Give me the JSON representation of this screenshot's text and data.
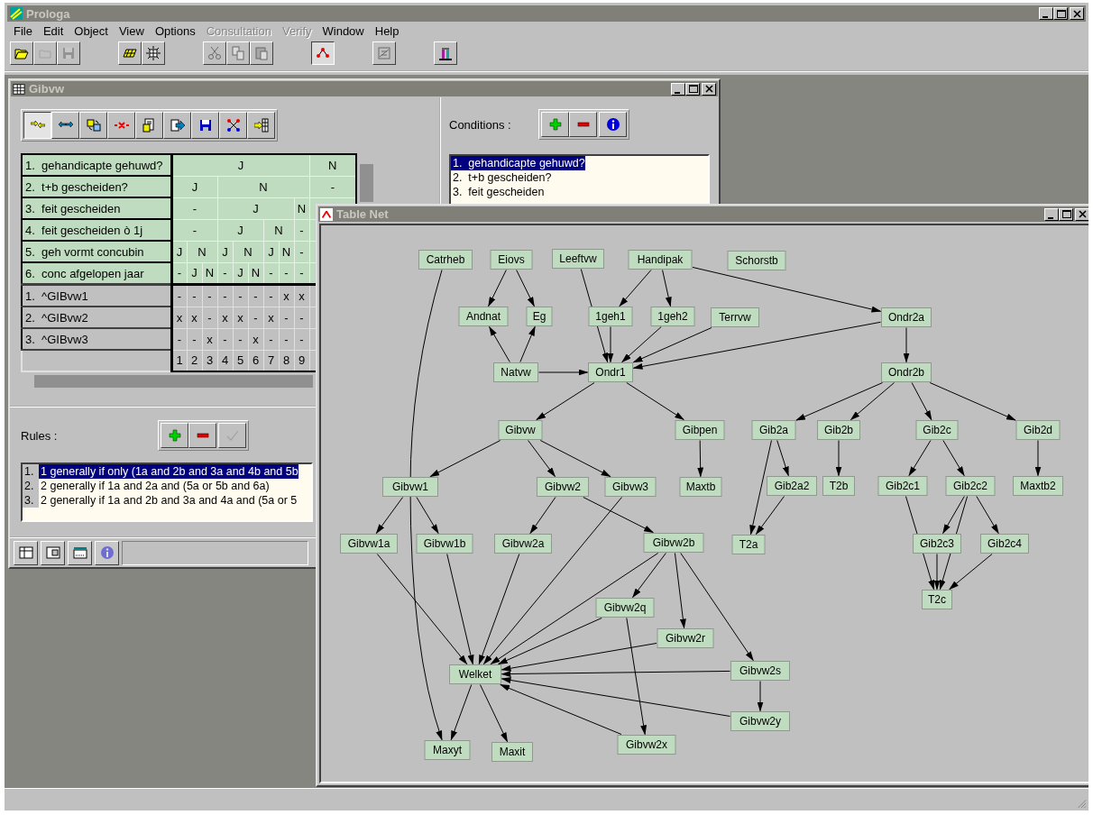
{
  "app": {
    "title": "Prologa"
  },
  "menu": [
    {
      "label": "File",
      "disabled": false
    },
    {
      "label": "Edit",
      "disabled": false
    },
    {
      "label": "Object",
      "disabled": false
    },
    {
      "label": "View",
      "disabled": false
    },
    {
      "label": "Options",
      "disabled": false
    },
    {
      "label": "Consultation",
      "disabled": true
    },
    {
      "label": "Verify",
      "disabled": true
    },
    {
      "label": "Window",
      "disabled": false
    },
    {
      "label": "Help",
      "disabled": false
    }
  ],
  "toolbar": {
    "groups": [
      {
        "buttons": [
          {
            "kind": "open",
            "disabled": false,
            "pressed": false
          },
          {
            "kind": "folder",
            "disabled": true,
            "pressed": false
          },
          {
            "kind": "save",
            "disabled": true,
            "pressed": false
          }
        ]
      },
      {
        "buttons": [
          {
            "kind": "grid-entry",
            "disabled": false,
            "pressed": false
          },
          {
            "kind": "grid",
            "disabled": false,
            "pressed": false
          }
        ]
      },
      {
        "buttons": [
          {
            "kind": "cut",
            "disabled": true,
            "pressed": false
          },
          {
            "kind": "copy",
            "disabled": true,
            "pressed": false
          },
          {
            "kind": "paste",
            "disabled": true,
            "pressed": false
          }
        ]
      },
      {
        "buttons": [
          {
            "kind": "net",
            "disabled": false,
            "pressed": true
          }
        ]
      },
      {
        "buttons": [
          {
            "kind": "compare",
            "disabled": true,
            "pressed": false
          }
        ]
      },
      {
        "buttons": [
          {
            "kind": "chart",
            "disabled": false,
            "pressed": false
          }
        ]
      }
    ]
  },
  "gibvw_window": {
    "title": "Gibvw",
    "toolbar": [
      {
        "kind": "merge",
        "pressed": true
      },
      {
        "kind": "split",
        "pressed": false
      },
      {
        "kind": "swap",
        "pressed": false
      },
      {
        "kind": "delete",
        "pressed": false
      },
      {
        "kind": "document",
        "pressed": false
      },
      {
        "kind": "export",
        "pressed": false
      },
      {
        "kind": "save-blue",
        "pressed": false
      },
      {
        "kind": "network",
        "pressed": false
      },
      {
        "kind": "table-arrow",
        "pressed": false
      }
    ],
    "conditions": [
      "1.  gehandicapte gehuwd?",
      "2.  t+b gescheiden?",
      "3.  feit gescheiden",
      "4.  feit gescheiden ò 1j",
      "5.  geh vormt concubin",
      "6.  conc afgelopen jaar"
    ],
    "decision_tree": [
      {
        "value": "J",
        "children": [
          {
            "value": "J",
            "children": [
              {
                "value": "-",
                "children": [
                  {
                    "value": "-",
                    "children": [
                      {
                        "value": "J",
                        "children": [
                          {
                            "value": "-"
                          }
                        ]
                      },
                      {
                        "value": "N",
                        "children": [
                          {
                            "value": "J"
                          },
                          {
                            "value": "N"
                          }
                        ]
                      }
                    ]
                  }
                ]
              }
            ]
          },
          {
            "value": "N",
            "children": [
              {
                "value": "J",
                "children": [
                  {
                    "value": "J",
                    "children": [
                      {
                        "value": "J",
                        "children": [
                          {
                            "value": "-"
                          }
                        ]
                      },
                      {
                        "value": "N",
                        "children": [
                          {
                            "value": "J"
                          },
                          {
                            "value": "N"
                          }
                        ]
                      }
                    ]
                  },
                  {
                    "value": "N",
                    "children": [
                      {
                        "value": "J",
                        "children": [
                          {
                            "value": "-"
                          }
                        ]
                      },
                      {
                        "value": "N",
                        "children": [
                          {
                            "value": "-"
                          }
                        ]
                      }
                    ]
                  }
                ]
              },
              {
                "value": "N",
                "children": [
                  {
                    "value": "-",
                    "children": [
                      {
                        "value": "-",
                        "children": [
                          {
                            "value": "-"
                          }
                        ]
                      }
                    ]
                  }
                ]
              }
            ]
          }
        ]
      },
      {
        "value": "N",
        "children": [
          {
            "value": "-"
          }
        ]
      }
    ],
    "actions": [
      {
        "label": "1.  ^GIBvw1",
        "marks": [
          "-",
          "-",
          "-",
          "-",
          "-",
          "-",
          "-",
          "x",
          "x"
        ]
      },
      {
        "label": "2.  ^GIBvw2",
        "marks": [
          "x",
          "x",
          "-",
          "x",
          "x",
          "-",
          "x",
          "-",
          "-"
        ]
      },
      {
        "label": "3.  ^GIBvw3",
        "marks": [
          "-",
          "-",
          "x",
          "-",
          "-",
          "x",
          "-",
          "-",
          "-"
        ]
      }
    ],
    "rule_numbers": [
      "1",
      "2",
      "3",
      "4",
      "5",
      "6",
      "7",
      "8",
      "9"
    ],
    "conditions_panel": {
      "label": "Conditions :",
      "buttons": [
        {
          "kind": "plus",
          "disabled": false
        },
        {
          "kind": "minus",
          "disabled": false
        },
        {
          "kind": "info",
          "disabled": false
        }
      ],
      "items": [
        {
          "text": "1.  gehandicapte gehuwd?",
          "selected": true
        },
        {
          "text": "2.  t+b gescheiden?",
          "selected": false
        },
        {
          "text": "3.  feit gescheiden",
          "selected": false
        }
      ]
    },
    "rules_panel": {
      "label": "Rules :",
      "buttons": [
        {
          "kind": "plus",
          "disabled": false
        },
        {
          "kind": "minus",
          "disabled": false
        },
        {
          "kind": "check",
          "disabled": true
        }
      ],
      "items": [
        {
          "number": "1.",
          "text": "1 generally if only (1a and 2b and 3a and 4b and 5b",
          "selected": true
        },
        {
          "number": "2.",
          "text": "2 generally if 1a and 2a and (5a or 5b and 6a)",
          "selected": false
        },
        {
          "number": "3.",
          "text": "2 generally if 1a and 2b and 3a and 4a and (5a or 5",
          "selected": false
        }
      ]
    },
    "bottom_toolbar": [
      {
        "kind": "table",
        "disabled": false
      },
      {
        "kind": "window",
        "disabled": false
      },
      {
        "kind": "keyboard",
        "disabled": false
      },
      {
        "kind": "info",
        "disabled": true
      }
    ]
  },
  "table_net_window": {
    "title": "Table Net",
    "nodes": [
      {
        "label": "Catrheb"
      },
      {
        "label": "Eiovs"
      },
      {
        "label": "Leeftvw"
      },
      {
        "label": "Handipak"
      },
      {
        "label": "Schorstb"
      },
      {
        "label": "Andnat"
      },
      {
        "label": "Eg"
      },
      {
        "label": "1geh1"
      },
      {
        "label": "1geh2"
      },
      {
        "label": "Terrvw"
      },
      {
        "label": "Ondr2a"
      },
      {
        "label": "Natvw"
      },
      {
        "label": "Ondr1"
      },
      {
        "label": "Ondr2b"
      },
      {
        "label": "Gibvw"
      },
      {
        "label": "Gibpen"
      },
      {
        "label": "Gib2a"
      },
      {
        "label": "Gib2b"
      },
      {
        "label": "Gib2c"
      },
      {
        "label": "Gib2d"
      },
      {
        "label": "Gibvw1"
      },
      {
        "label": "Gibvw2"
      },
      {
        "label": "Gibvw3"
      },
      {
        "label": "Maxtb"
      },
      {
        "label": "Gib2a2"
      },
      {
        "label": "T2b"
      },
      {
        "label": "Gib2c1"
      },
      {
        "label": "Gib2c2"
      },
      {
        "label": "Maxtb2"
      },
      {
        "label": "Gibvw1a"
      },
      {
        "label": "Gibvw1b"
      },
      {
        "label": "Gibvw2a"
      },
      {
        "label": "Gibvw2b"
      },
      {
        "label": "T2a"
      },
      {
        "label": "Gib2c3"
      },
      {
        "label": "Gib2c4"
      },
      {
        "label": "T2c"
      },
      {
        "label": "Gibvw2q"
      },
      {
        "label": "Gibvw2r"
      },
      {
        "label": "Welket"
      },
      {
        "label": "Gibvw2s"
      },
      {
        "label": "Gibvw2y"
      },
      {
        "label": "Gibvw2x"
      },
      {
        "label": "Maxyt"
      },
      {
        "label": "Maxit"
      }
    ]
  }
}
